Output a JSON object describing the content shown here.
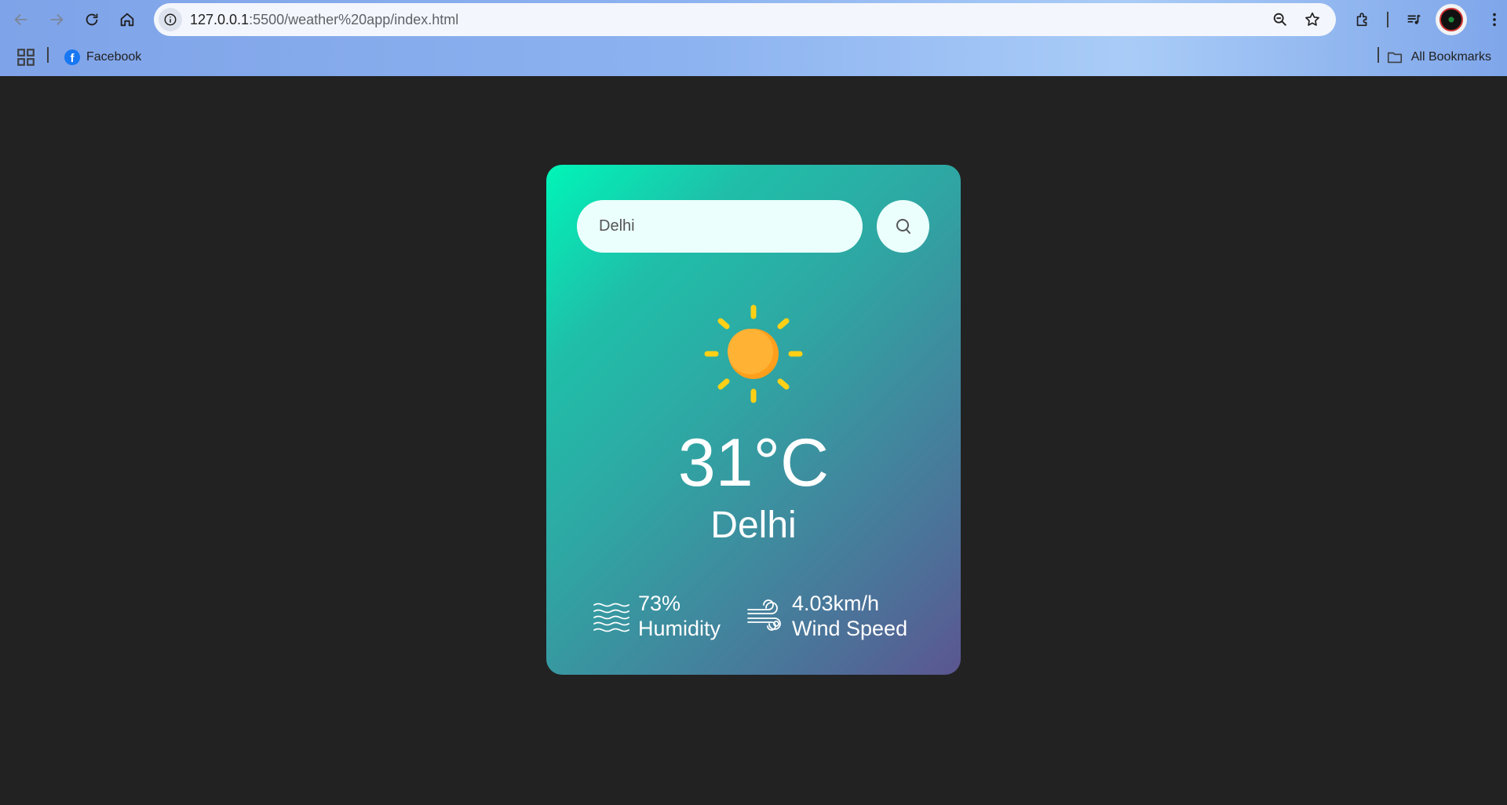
{
  "browser": {
    "url_host": "127.0.0.1",
    "url_path": ":5500/weather%20app/index.html",
    "bookmarks": [
      {
        "label": "Facebook",
        "icon": "facebook-icon"
      }
    ],
    "all_bookmarks_label": "All Bookmarks"
  },
  "weather": {
    "search_value": "Delhi",
    "temperature": "31°C",
    "city": "Delhi",
    "humidity_value": "73%",
    "humidity_label": "Humidity",
    "wind_value": "4.03km/h",
    "wind_label": "Wind Speed",
    "condition_icon": "sun-icon"
  },
  "colors": {
    "page_background": "#222222",
    "card_gradient_start": "#00f5b8",
    "card_gradient_end": "#5b5590",
    "input_background": "#ebfffc",
    "sun": "#ffb234",
    "sun_rays": "#ffd015"
  }
}
